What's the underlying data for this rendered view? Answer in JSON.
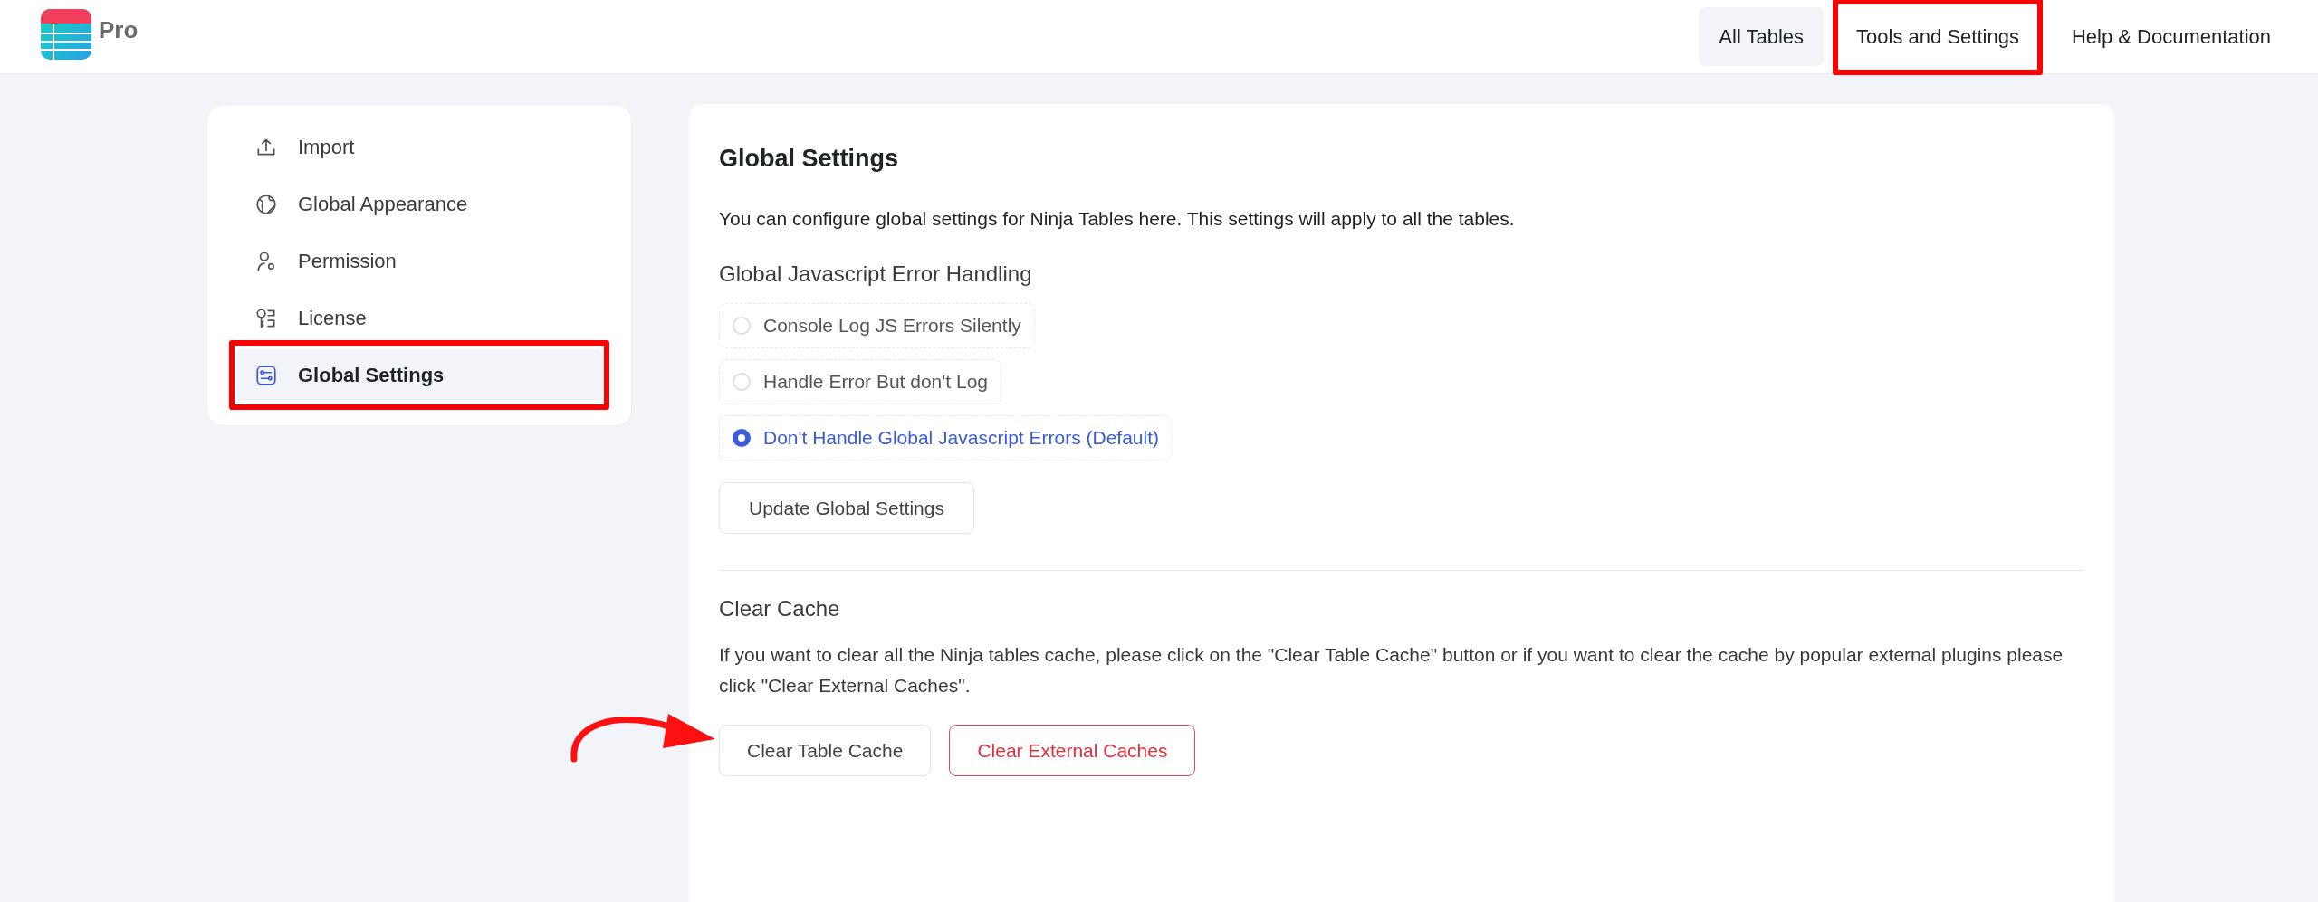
{
  "header": {
    "brand": "Pro",
    "nav": [
      {
        "label": "All Tables",
        "selected": true,
        "annotated": false
      },
      {
        "label": "Tools and Settings",
        "selected": false,
        "annotated": true
      },
      {
        "label": "Help & Documentation",
        "selected": false,
        "annotated": false
      }
    ]
  },
  "sidebar": {
    "items": [
      {
        "label": "Import",
        "kind": "upload",
        "selected": false,
        "annotated": false
      },
      {
        "label": "Global Appearance",
        "kind": "globe",
        "selected": false,
        "annotated": false
      },
      {
        "label": "Permission",
        "kind": "user",
        "selected": false,
        "annotated": false
      },
      {
        "label": "License",
        "kind": "key",
        "selected": false,
        "annotated": false
      },
      {
        "label": "Global Settings",
        "kind": "settings",
        "selected": true,
        "annotated": true
      }
    ]
  },
  "main": {
    "title": "Global Settings",
    "description": "You can configure global settings for Ninja Tables here. This settings will apply to all the tables.",
    "error_handling": {
      "heading": "Global Javascript Error Handling",
      "options": [
        {
          "label": "Console Log JS Errors Silently",
          "selected": false
        },
        {
          "label": "Handle Error But don't Log",
          "selected": false
        },
        {
          "label": "Don't Handle Global Javascript Errors (Default)",
          "selected": true
        }
      ],
      "button": "Update Global Settings"
    },
    "clear_cache": {
      "heading": "Clear Cache",
      "description": "If you want to clear all the Ninja tables cache, please click on the \"Clear Table Cache\" button or if you want to clear the cache by popular external plugins please click \"Clear External Caches\".",
      "buttons": [
        {
          "label": "Clear Table Cache",
          "kind": "default",
          "annotated": true
        },
        {
          "label": "Clear External Caches",
          "kind": "danger",
          "annotated": false
        }
      ]
    }
  }
}
